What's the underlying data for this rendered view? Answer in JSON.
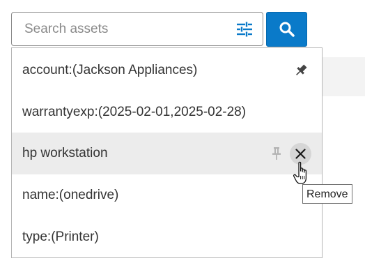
{
  "search": {
    "placeholder": "Search assets",
    "value": ""
  },
  "icons": {
    "filter": "sliders-icon",
    "search": "magnifier-icon",
    "pin": "pin-icon",
    "remove": "close-icon"
  },
  "colors": {
    "accent": "#0a7ac9",
    "highlight_row": "#ececec",
    "pin_active": "#444444",
    "pin_inactive": "#b3b3b3"
  },
  "suggestions": [
    {
      "label": "account:(Jackson Appliances)",
      "pinned": true
    },
    {
      "label": "warrantyexp:(2025-02-01,2025-02-28)",
      "pinned": false
    },
    {
      "label": "hp workstation",
      "pinned": false,
      "hovered": true
    },
    {
      "label": "name:(onedrive)",
      "pinned": false
    },
    {
      "label": "type:(Printer)",
      "pinned": false
    }
  ],
  "tooltip": {
    "text": "Remove"
  }
}
